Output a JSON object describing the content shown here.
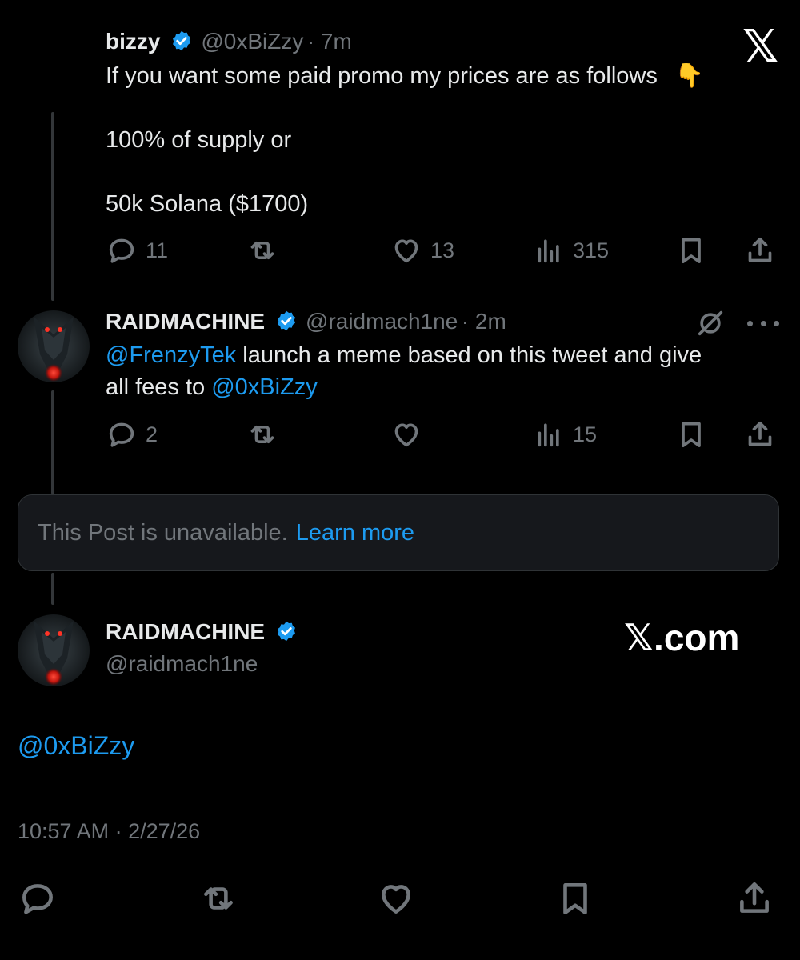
{
  "tweet1": {
    "name": "bizzy",
    "handle": "@0xBiZzy",
    "time": "· 7m",
    "text_line1": "If you want some paid promo my prices are as follows",
    "emoji": "👇",
    "text_line2": "100% of supply or",
    "text_line3": "50k Solana ($1700)",
    "replies": "11",
    "retweets": "",
    "likes": "13",
    "views": "315"
  },
  "x_logo": "𝕏",
  "tweet2": {
    "name": "RAIDMACHINE",
    "handle": "@raidmach1ne",
    "time": "· 2m",
    "mention1": "@FrenzyTek",
    "text_mid": " launch a meme based on this tweet and give",
    "text_line2_pre": "all fees to ",
    "mention2": "@0xBiZzy",
    "replies": "2",
    "views": "15"
  },
  "unavailable": {
    "text": "This Post is unavailable.",
    "link": "Learn more"
  },
  "main_tweet": {
    "name": "RAIDMACHINE",
    "handle": "@raidmach1ne",
    "watermark": "𝕏.com",
    "text": "@0xBiZzy",
    "timestamp": "10:57 AM · 2/27/26"
  },
  "colors": {
    "background": "#000000",
    "text": "#e7e9ea",
    "muted": "#71767b",
    "accent": "#1d9bf0"
  }
}
